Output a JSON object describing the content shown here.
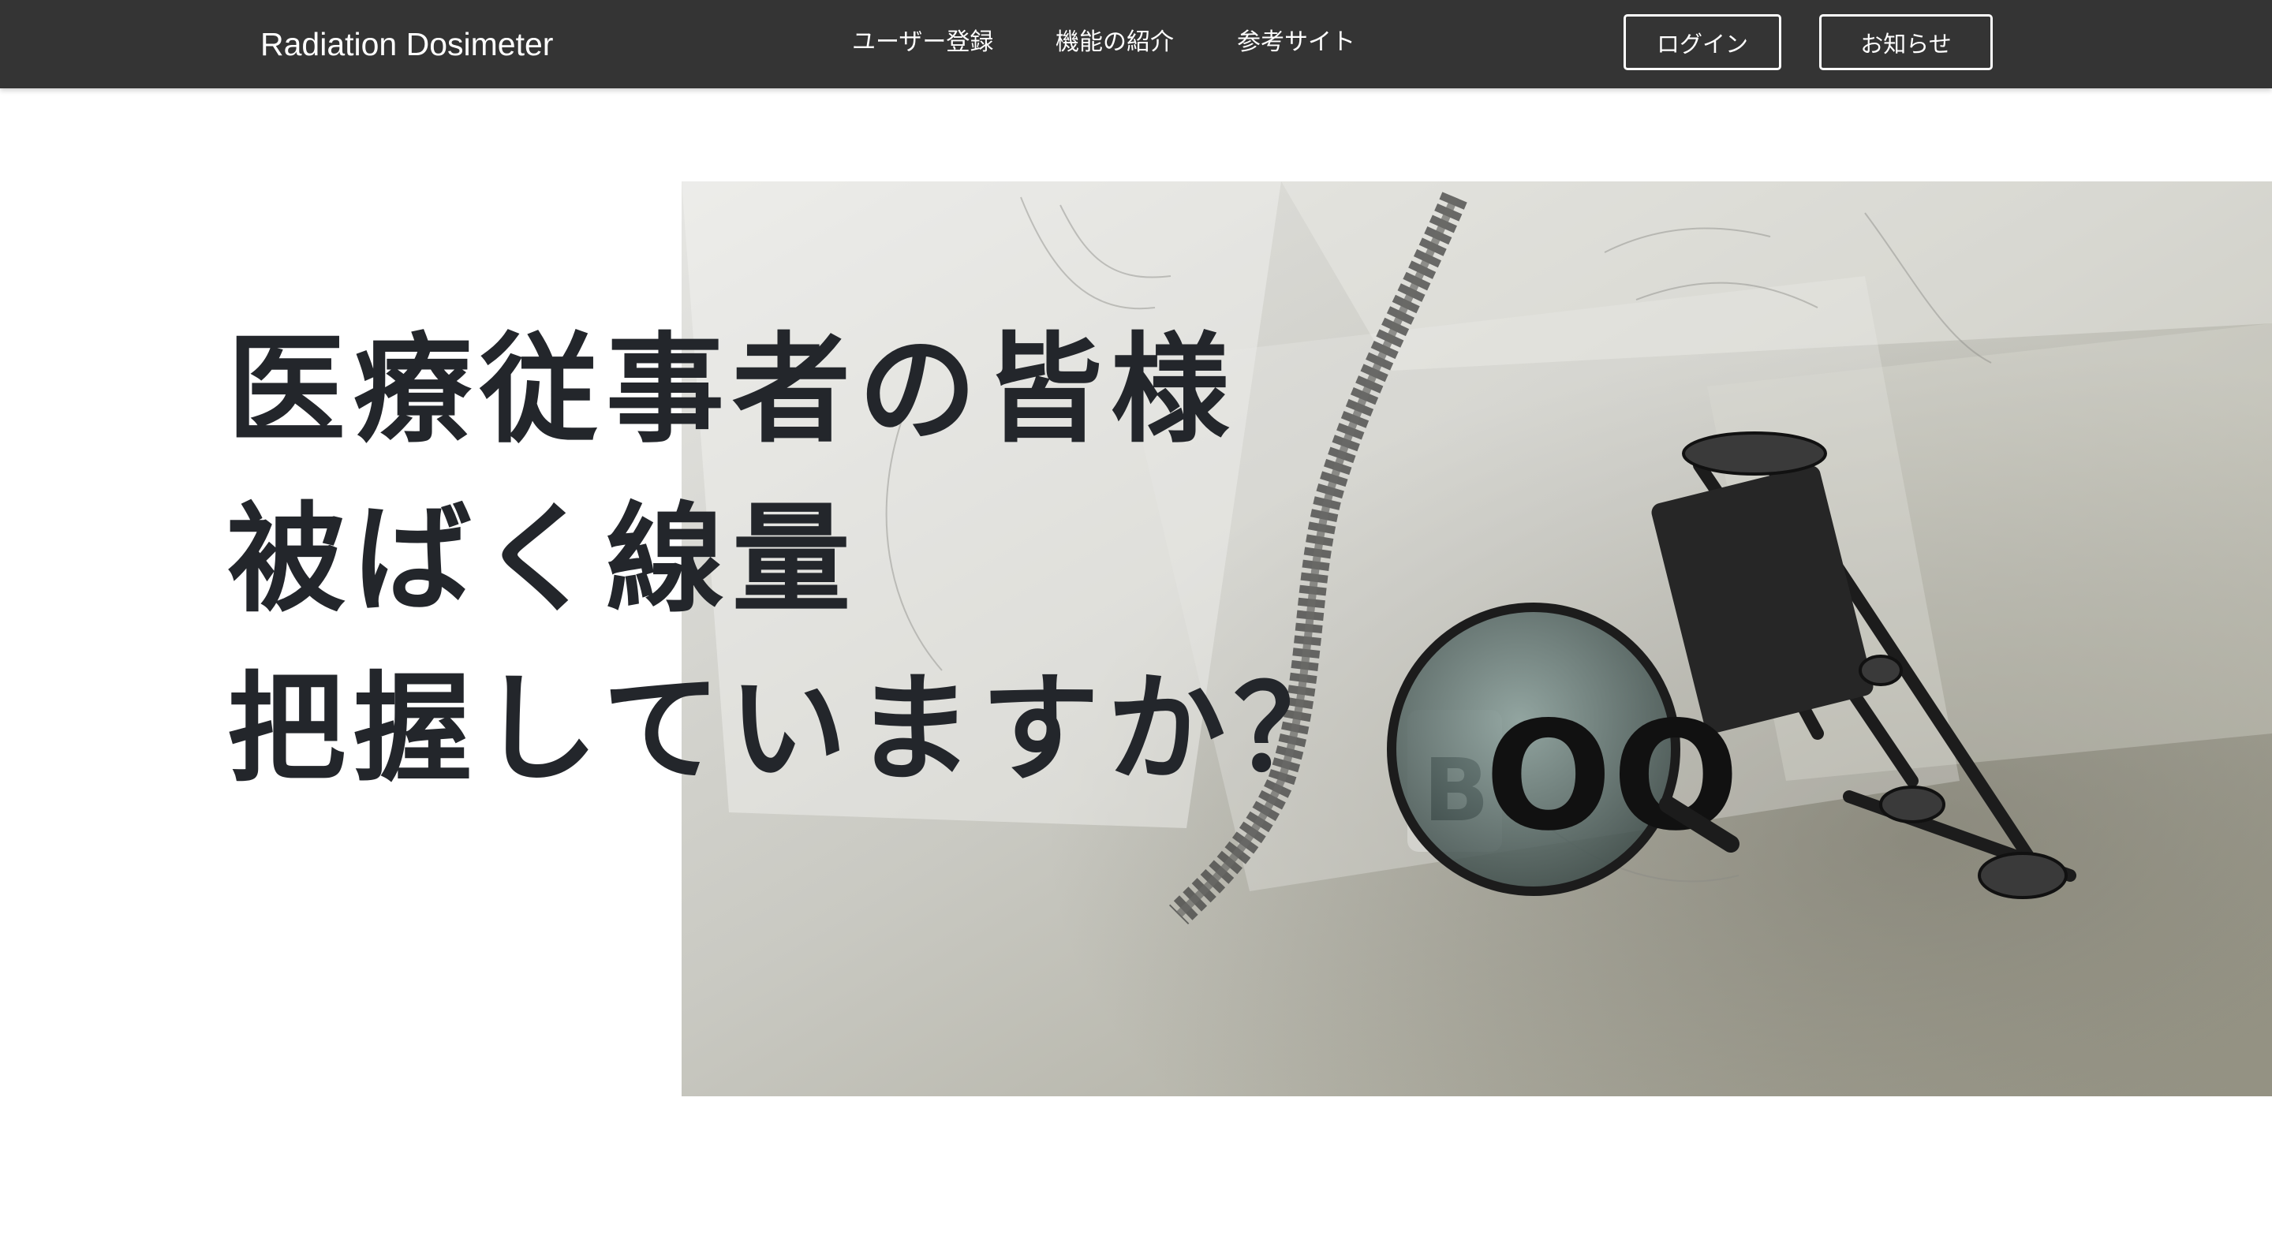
{
  "navbar": {
    "brand": "Radiation Dosimeter",
    "links": [
      "ユーザー登録",
      "機能の紹介",
      "参考サイト"
    ],
    "login_label": "ログイン",
    "news_label": "お知らせ",
    "background": "#343434"
  },
  "hero": {
    "lines": [
      "医療従事者の皆様",
      "被ばく線量",
      "把握していますか？"
    ],
    "image_text": "BOO",
    "text_color": "#23262b"
  }
}
